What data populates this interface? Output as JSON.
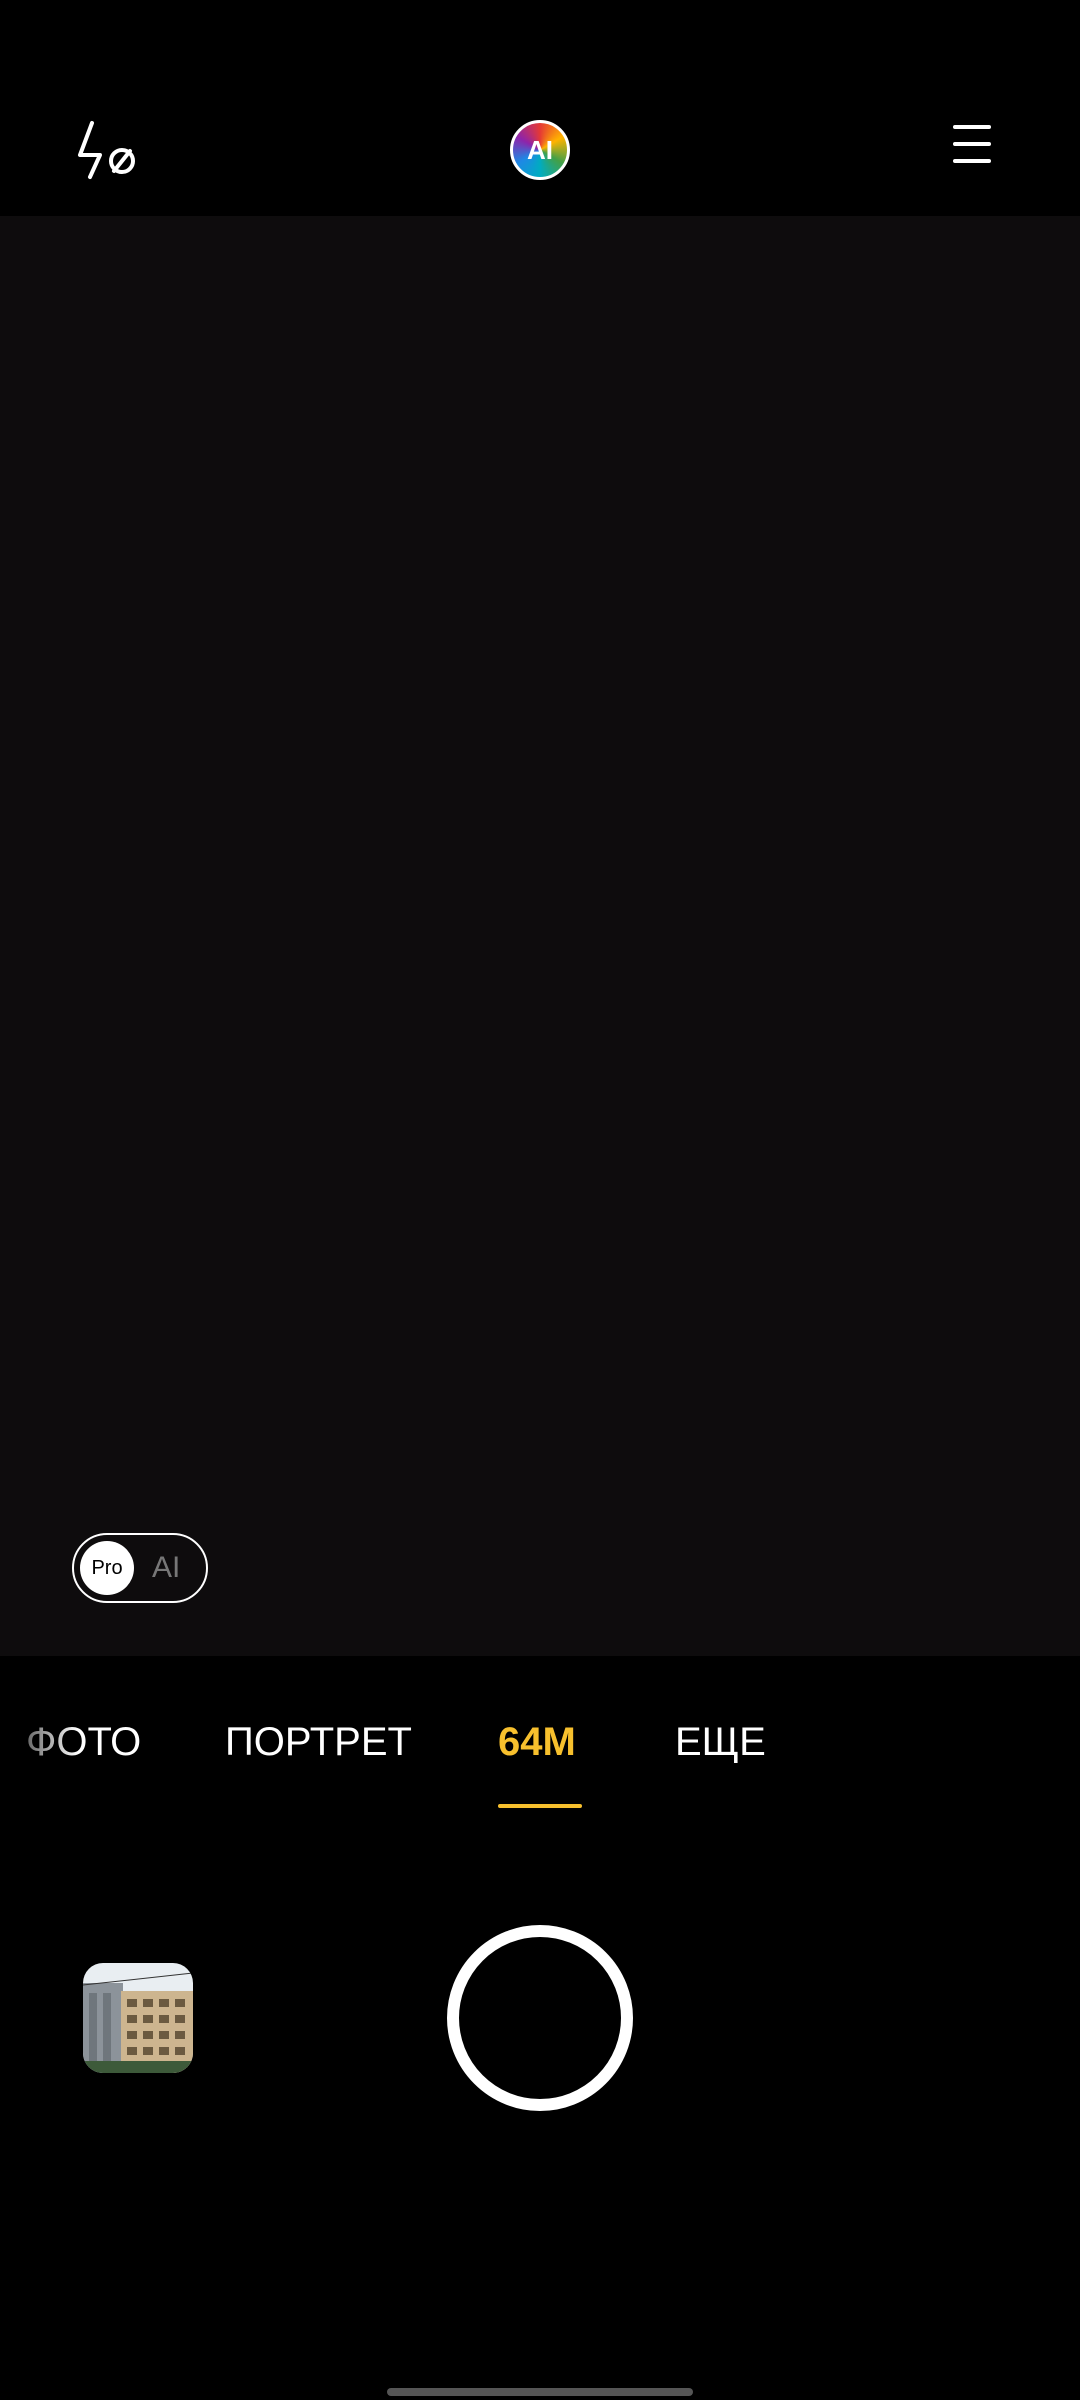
{
  "top_bar": {
    "flash_icon": "flash-off-icon",
    "ai_label": "AI",
    "menu_icon": "menu-icon"
  },
  "viewfinder": {
    "mode_toggle": {
      "selected": "Pro",
      "pro_label": "Pro",
      "ai_label": "AI"
    }
  },
  "modes": {
    "items": [
      {
        "label": "ФОТО",
        "active": false
      },
      {
        "label": "ПОРТРЕТ",
        "active": false
      },
      {
        "label": "64M",
        "active": true
      },
      {
        "label": "ЕЩЕ",
        "active": false
      }
    ],
    "active_color": "#f7c02d"
  },
  "bottom": {
    "gallery_icon": "gallery-thumbnail-icon",
    "shutter_icon": "shutter-button-icon"
  },
  "colors": {
    "background": "#000000",
    "viewfinder": "#0e0c0d",
    "accent": "#f7c02d"
  }
}
